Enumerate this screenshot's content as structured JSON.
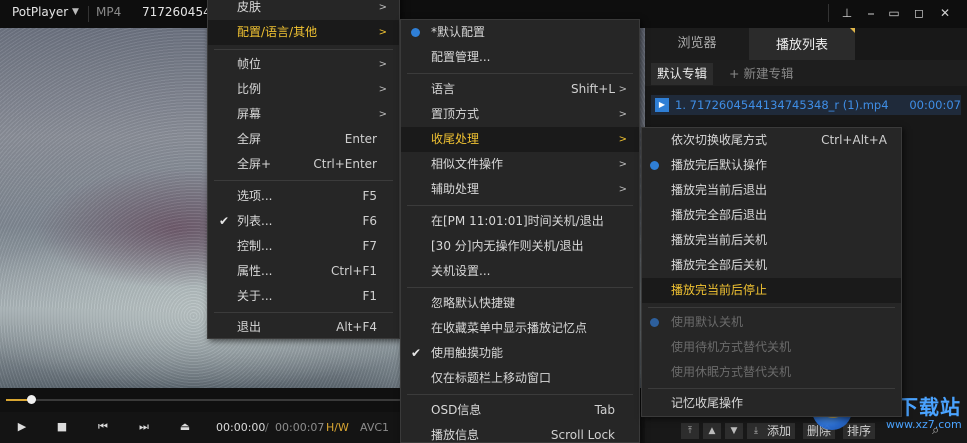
{
  "titlebar": {
    "app_name": "PotPlayer",
    "format": "MP4",
    "filename": "717260454",
    "buttons": [
      "pin",
      "minimize-to-tray",
      "minimize",
      "maximize",
      "close"
    ]
  },
  "controls": {
    "time_current": "00:00:00",
    "time_separator": "/",
    "time_total": "00:00:07",
    "hw_label": "H/W",
    "codec_label": "AVC1",
    "seek_progress": 0.04
  },
  "panel": {
    "tabs": [
      "浏览器",
      "播放列表"
    ],
    "active_tab": "播放列表",
    "albums": [
      "默认专辑",
      "+ 新建专辑"
    ],
    "playlist": [
      {
        "name": "1. 7172604544134745348_r (1).mp4",
        "duration": "00:00:07"
      }
    ],
    "bottom_buttons": [
      "添加",
      "删除",
      "排序"
    ]
  },
  "watermark": {
    "text": "极光下载站",
    "url": "www.xz7.com"
  },
  "menu_main": {
    "items": [
      {
        "label": "皮肤",
        "arrow": true
      },
      {
        "label": "配置/语言/其他",
        "arrow": true,
        "highlight": true
      },
      {
        "label": "帧位",
        "arrow": true
      },
      {
        "label": "比例",
        "arrow": true
      },
      {
        "label": "屏幕",
        "arrow": true
      },
      {
        "label": "全屏",
        "shortcut": "Enter"
      },
      {
        "label": "全屏+",
        "shortcut": "Ctrl+Enter"
      },
      {
        "label": "选项...",
        "shortcut": "F5"
      },
      {
        "label": "列表...",
        "shortcut": "F6",
        "checked": true
      },
      {
        "label": "控制...",
        "shortcut": "F7"
      },
      {
        "label": "属性...",
        "shortcut": "Ctrl+F1"
      },
      {
        "label": "关于...",
        "shortcut": "F1"
      },
      {
        "label": "退出",
        "shortcut": "Alt+F4"
      }
    ]
  },
  "menu_config": {
    "items": [
      {
        "label": "*默认配置",
        "radio": true
      },
      {
        "label": "配置管理..."
      },
      {
        "label": "语言",
        "shortcut": "Shift+L",
        "arrow": true
      },
      {
        "label": "置顶方式",
        "arrow": true
      },
      {
        "label": "收尾处理",
        "arrow": true,
        "highlight": true
      },
      {
        "label": "相似文件操作",
        "arrow": true
      },
      {
        "label": "辅助处理",
        "arrow": true
      },
      {
        "label": "在[PM 11:01:01]时间关机/退出"
      },
      {
        "label": "[30 分]内无操作则关机/退出"
      },
      {
        "label": "关机设置..."
      },
      {
        "label": "忽略默认快捷键"
      },
      {
        "label": "在收藏菜单中显示播放记忆点"
      },
      {
        "label": "使用触摸功能",
        "checked": true
      },
      {
        "label": "仅在标题栏上移动窗口"
      },
      {
        "label": "OSD信息",
        "shortcut": "Tab"
      },
      {
        "label": "播放信息",
        "shortcut": "Scroll Lock"
      }
    ]
  },
  "menu_end": {
    "items": [
      {
        "label": "依次切换收尾方式",
        "shortcut": "Ctrl+Alt+A"
      },
      {
        "label": "播放完后默认操作",
        "radio": true
      },
      {
        "label": "播放完当前后退出"
      },
      {
        "label": "播放完全部后退出"
      },
      {
        "label": "播放完当前后关机"
      },
      {
        "label": "播放完全部后关机"
      },
      {
        "label": "播放完当前后停止",
        "highlight": true
      },
      {
        "label": "使用默认关机",
        "radio": true,
        "disabled": true
      },
      {
        "label": "使用待机方式替代关机",
        "disabled": true
      },
      {
        "label": "使用休眠方式替代关机",
        "disabled": true
      },
      {
        "label": "记忆收尾操作"
      }
    ]
  }
}
